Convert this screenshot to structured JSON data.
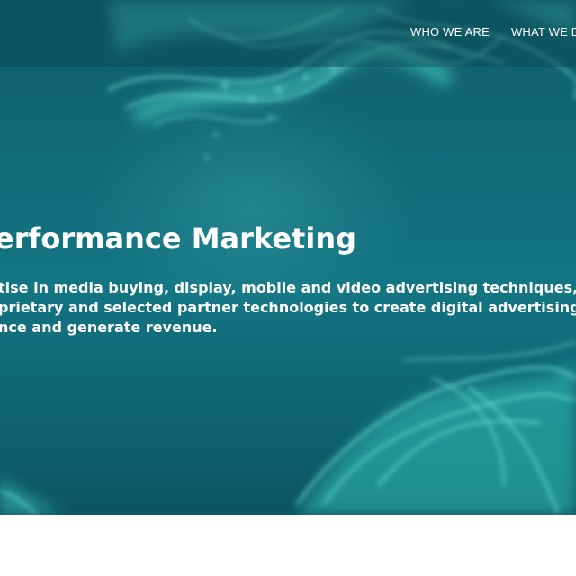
{
  "nav": {
    "items": [
      {
        "label": "WHO WE ARE"
      },
      {
        "label": "WHAT WE DO"
      }
    ]
  },
  "hero": {
    "headline": "erformance Marketing",
    "intro_lines": [
      "tise in media buying, display, mobile and video advertising techniques, a",
      "prietary and selected partner technologies to create digital advertising ca",
      "nce and generate revenue."
    ]
  },
  "colors": {
    "hero_background": "#126b78",
    "smoke_accent": "#4fe3d2",
    "text": "#ffffff",
    "page_background": "#ffffff"
  }
}
